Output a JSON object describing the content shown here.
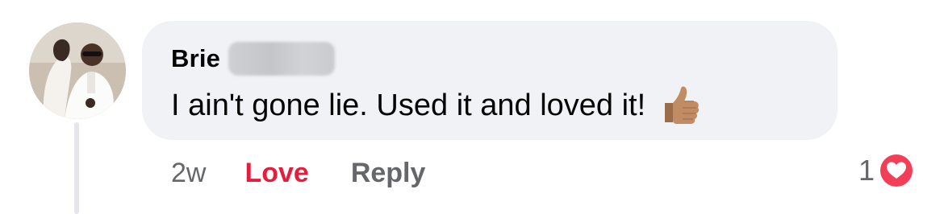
{
  "comment": {
    "author": "Brie",
    "text": "I ain't gone lie. Used it and loved it!",
    "emoji": "thumbs-up-icon"
  },
  "actions": {
    "timestamp": "2w",
    "love_label": "Love",
    "reply_label": "Reply"
  },
  "reactions": {
    "count": "1",
    "type": "heart-icon",
    "color": "#f33e58"
  },
  "colors": {
    "bubble": "#f0f2f5",
    "love_active": "#e41e3f",
    "secondary_text": "#65676b",
    "primary_text": "#050505"
  }
}
